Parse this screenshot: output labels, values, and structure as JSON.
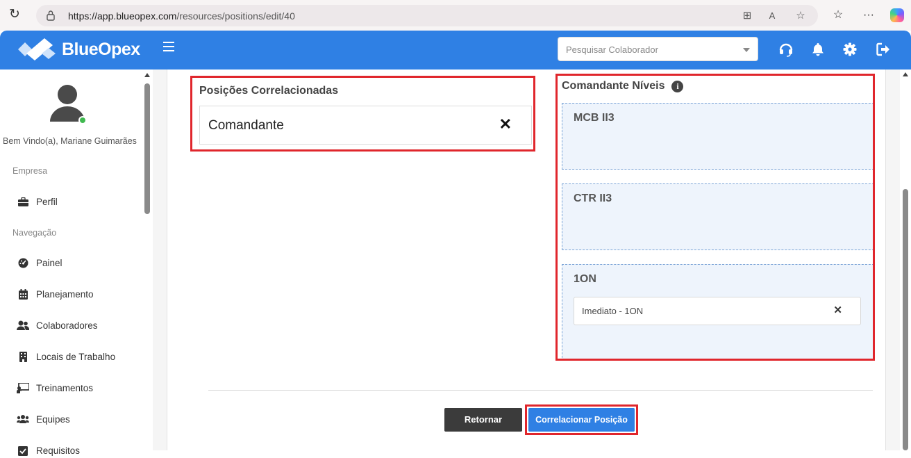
{
  "browser": {
    "url_host": "https://app.blueopex.com",
    "url_path": "/resources/positions/edit/40"
  },
  "header": {
    "brand": "BlueOpex",
    "search_placeholder": "Pesquisar Colaborador"
  },
  "sidebar": {
    "welcome": "Bem Vindo(a), Mariane Guimarães",
    "section_company": "Empresa",
    "section_nav": "Navegação",
    "items": [
      {
        "label": "Perfil",
        "icon": "briefcase-icon"
      },
      {
        "label": "Painel",
        "icon": "dashboard-icon"
      },
      {
        "label": "Planejamento",
        "icon": "calendar-icon"
      },
      {
        "label": "Colaboradores",
        "icon": "users-icon"
      },
      {
        "label": "Locais de Trabalho",
        "icon": "building-icon"
      },
      {
        "label": "Treinamentos",
        "icon": "training-icon"
      },
      {
        "label": "Equipes",
        "icon": "team-icon"
      },
      {
        "label": "Requisitos",
        "icon": "requirements-icon"
      }
    ]
  },
  "main": {
    "related_title": "Posições Correlacionadas",
    "related_items": [
      "Comandante"
    ],
    "levels_title": "Comandante Níveis",
    "levels": [
      {
        "name": "MCB II3",
        "chips": []
      },
      {
        "name": "CTR II3",
        "chips": []
      },
      {
        "name": "1ON",
        "chips": [
          "Imediato - 1ON"
        ]
      }
    ],
    "back_button": "Retornar",
    "correlate_button": "Correlacionar Posição"
  },
  "colors": {
    "primary": "#2f80e4",
    "highlight": "#e0262c",
    "dark_button": "#3b3b3b",
    "status_online": "#3fb94f"
  }
}
